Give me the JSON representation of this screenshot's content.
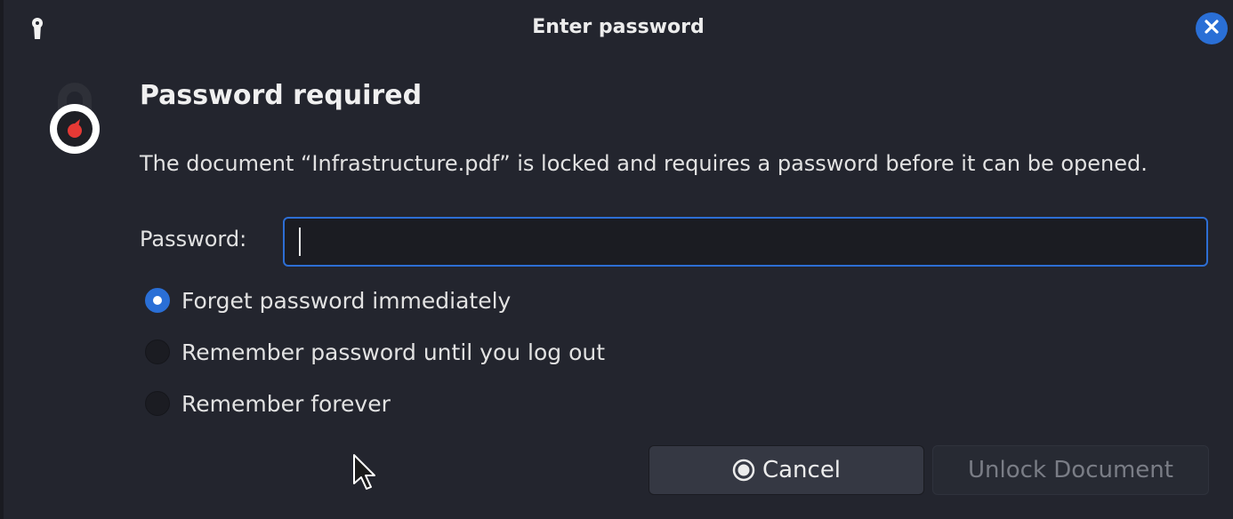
{
  "titlebar": {
    "title": "Enter password",
    "icon": "keyhole-icon",
    "close_icon": "close-icon",
    "accent_color": "#2a6fd6"
  },
  "dialog": {
    "icon": "lock-dialog-icon",
    "heading": "Password required",
    "message": "The document “Infrastructure.pdf” is locked and requires a password before it can be opened.",
    "password_label": "Password:",
    "password_value": "",
    "password_placeholder": ""
  },
  "remember_options": [
    {
      "label": "Forget password immediately",
      "checked": true
    },
    {
      "label": "Remember password until you log out",
      "checked": false
    },
    {
      "label": "Remember forever",
      "checked": false
    }
  ],
  "buttons": {
    "cancel_label": "Cancel",
    "cancel_icon": "cancel-icon",
    "unlock_label": "Unlock Document",
    "unlock_enabled": false
  },
  "colors": {
    "background": "#23252e",
    "input_border": "#2d6ed4",
    "icon_red": "#e53935"
  }
}
